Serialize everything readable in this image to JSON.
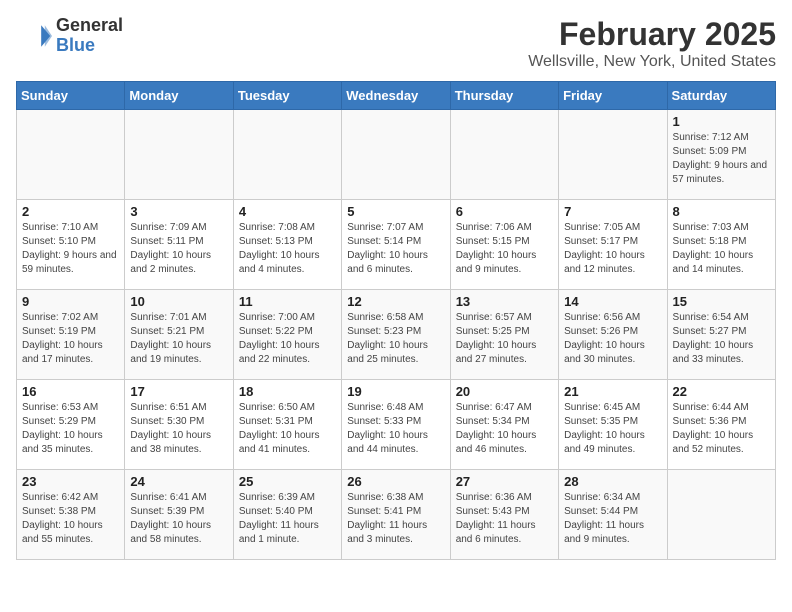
{
  "header": {
    "logo_general": "General",
    "logo_blue": "Blue",
    "title": "February 2025",
    "subtitle": "Wellsville, New York, United States"
  },
  "days_of_week": [
    "Sunday",
    "Monday",
    "Tuesday",
    "Wednesday",
    "Thursday",
    "Friday",
    "Saturday"
  ],
  "weeks": [
    [
      {
        "day": "",
        "info": ""
      },
      {
        "day": "",
        "info": ""
      },
      {
        "day": "",
        "info": ""
      },
      {
        "day": "",
        "info": ""
      },
      {
        "day": "",
        "info": ""
      },
      {
        "day": "",
        "info": ""
      },
      {
        "day": "1",
        "info": "Sunrise: 7:12 AM\nSunset: 5:09 PM\nDaylight: 9 hours and 57 minutes."
      }
    ],
    [
      {
        "day": "2",
        "info": "Sunrise: 7:10 AM\nSunset: 5:10 PM\nDaylight: 9 hours and 59 minutes."
      },
      {
        "day": "3",
        "info": "Sunrise: 7:09 AM\nSunset: 5:11 PM\nDaylight: 10 hours and 2 minutes."
      },
      {
        "day": "4",
        "info": "Sunrise: 7:08 AM\nSunset: 5:13 PM\nDaylight: 10 hours and 4 minutes."
      },
      {
        "day": "5",
        "info": "Sunrise: 7:07 AM\nSunset: 5:14 PM\nDaylight: 10 hours and 6 minutes."
      },
      {
        "day": "6",
        "info": "Sunrise: 7:06 AM\nSunset: 5:15 PM\nDaylight: 10 hours and 9 minutes."
      },
      {
        "day": "7",
        "info": "Sunrise: 7:05 AM\nSunset: 5:17 PM\nDaylight: 10 hours and 12 minutes."
      },
      {
        "day": "8",
        "info": "Sunrise: 7:03 AM\nSunset: 5:18 PM\nDaylight: 10 hours and 14 minutes."
      }
    ],
    [
      {
        "day": "9",
        "info": "Sunrise: 7:02 AM\nSunset: 5:19 PM\nDaylight: 10 hours and 17 minutes."
      },
      {
        "day": "10",
        "info": "Sunrise: 7:01 AM\nSunset: 5:21 PM\nDaylight: 10 hours and 19 minutes."
      },
      {
        "day": "11",
        "info": "Sunrise: 7:00 AM\nSunset: 5:22 PM\nDaylight: 10 hours and 22 minutes."
      },
      {
        "day": "12",
        "info": "Sunrise: 6:58 AM\nSunset: 5:23 PM\nDaylight: 10 hours and 25 minutes."
      },
      {
        "day": "13",
        "info": "Sunrise: 6:57 AM\nSunset: 5:25 PM\nDaylight: 10 hours and 27 minutes."
      },
      {
        "day": "14",
        "info": "Sunrise: 6:56 AM\nSunset: 5:26 PM\nDaylight: 10 hours and 30 minutes."
      },
      {
        "day": "15",
        "info": "Sunrise: 6:54 AM\nSunset: 5:27 PM\nDaylight: 10 hours and 33 minutes."
      }
    ],
    [
      {
        "day": "16",
        "info": "Sunrise: 6:53 AM\nSunset: 5:29 PM\nDaylight: 10 hours and 35 minutes."
      },
      {
        "day": "17",
        "info": "Sunrise: 6:51 AM\nSunset: 5:30 PM\nDaylight: 10 hours and 38 minutes."
      },
      {
        "day": "18",
        "info": "Sunrise: 6:50 AM\nSunset: 5:31 PM\nDaylight: 10 hours and 41 minutes."
      },
      {
        "day": "19",
        "info": "Sunrise: 6:48 AM\nSunset: 5:33 PM\nDaylight: 10 hours and 44 minutes."
      },
      {
        "day": "20",
        "info": "Sunrise: 6:47 AM\nSunset: 5:34 PM\nDaylight: 10 hours and 46 minutes."
      },
      {
        "day": "21",
        "info": "Sunrise: 6:45 AM\nSunset: 5:35 PM\nDaylight: 10 hours and 49 minutes."
      },
      {
        "day": "22",
        "info": "Sunrise: 6:44 AM\nSunset: 5:36 PM\nDaylight: 10 hours and 52 minutes."
      }
    ],
    [
      {
        "day": "23",
        "info": "Sunrise: 6:42 AM\nSunset: 5:38 PM\nDaylight: 10 hours and 55 minutes."
      },
      {
        "day": "24",
        "info": "Sunrise: 6:41 AM\nSunset: 5:39 PM\nDaylight: 10 hours and 58 minutes."
      },
      {
        "day": "25",
        "info": "Sunrise: 6:39 AM\nSunset: 5:40 PM\nDaylight: 11 hours and 1 minute."
      },
      {
        "day": "26",
        "info": "Sunrise: 6:38 AM\nSunset: 5:41 PM\nDaylight: 11 hours and 3 minutes."
      },
      {
        "day": "27",
        "info": "Sunrise: 6:36 AM\nSunset: 5:43 PM\nDaylight: 11 hours and 6 minutes."
      },
      {
        "day": "28",
        "info": "Sunrise: 6:34 AM\nSunset: 5:44 PM\nDaylight: 11 hours and 9 minutes."
      },
      {
        "day": "",
        "info": ""
      }
    ]
  ]
}
